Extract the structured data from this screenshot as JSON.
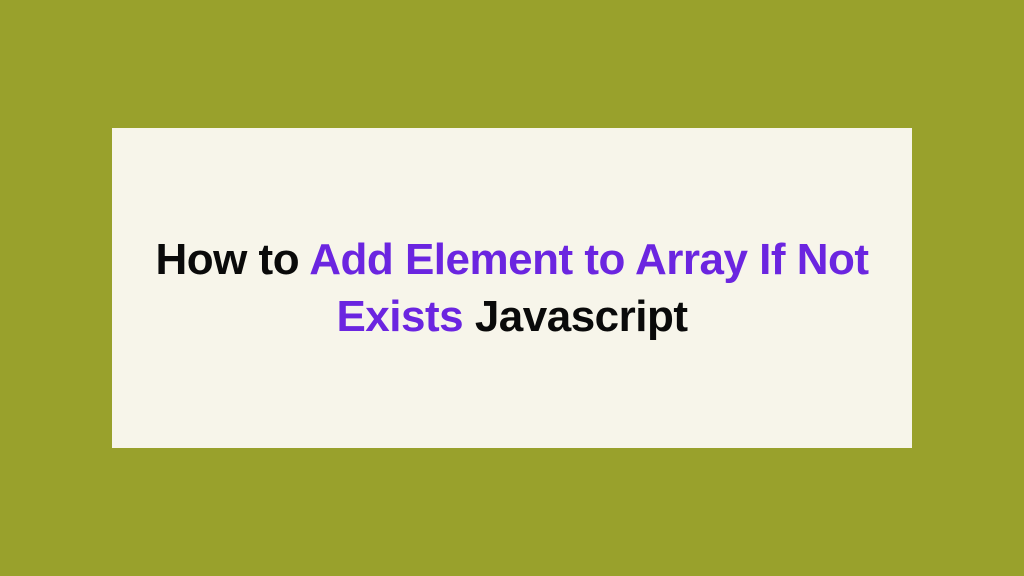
{
  "headline": {
    "part1": "How to ",
    "part2": "Add Element to Array If Not Exists",
    "part3": " Javascript"
  },
  "colors": {
    "background": "#99a12c",
    "card": "#f7f5ea",
    "textBlack": "#0a0a0a",
    "textPurple": "#6b25e0"
  }
}
